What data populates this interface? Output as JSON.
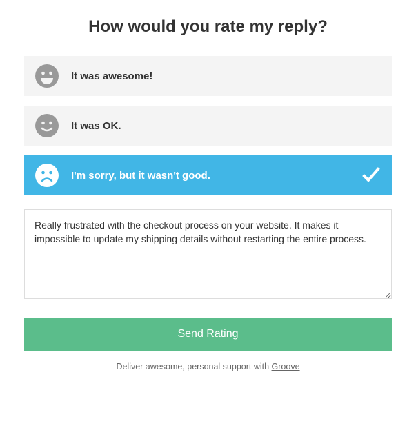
{
  "title": "How would you rate my reply?",
  "options": [
    {
      "label": "It was awesome!",
      "selected": false
    },
    {
      "label": "It was OK.",
      "selected": false
    },
    {
      "label": "I'm sorry, but it wasn't good.",
      "selected": true
    }
  ],
  "comment": "Really frustrated with the checkout process on your website. It makes it impossible to update my shipping details without restarting the entire process.",
  "submit_label": "Send Rating",
  "footer_text": "Deliver awesome, personal support with ",
  "footer_link_text": "Groove"
}
